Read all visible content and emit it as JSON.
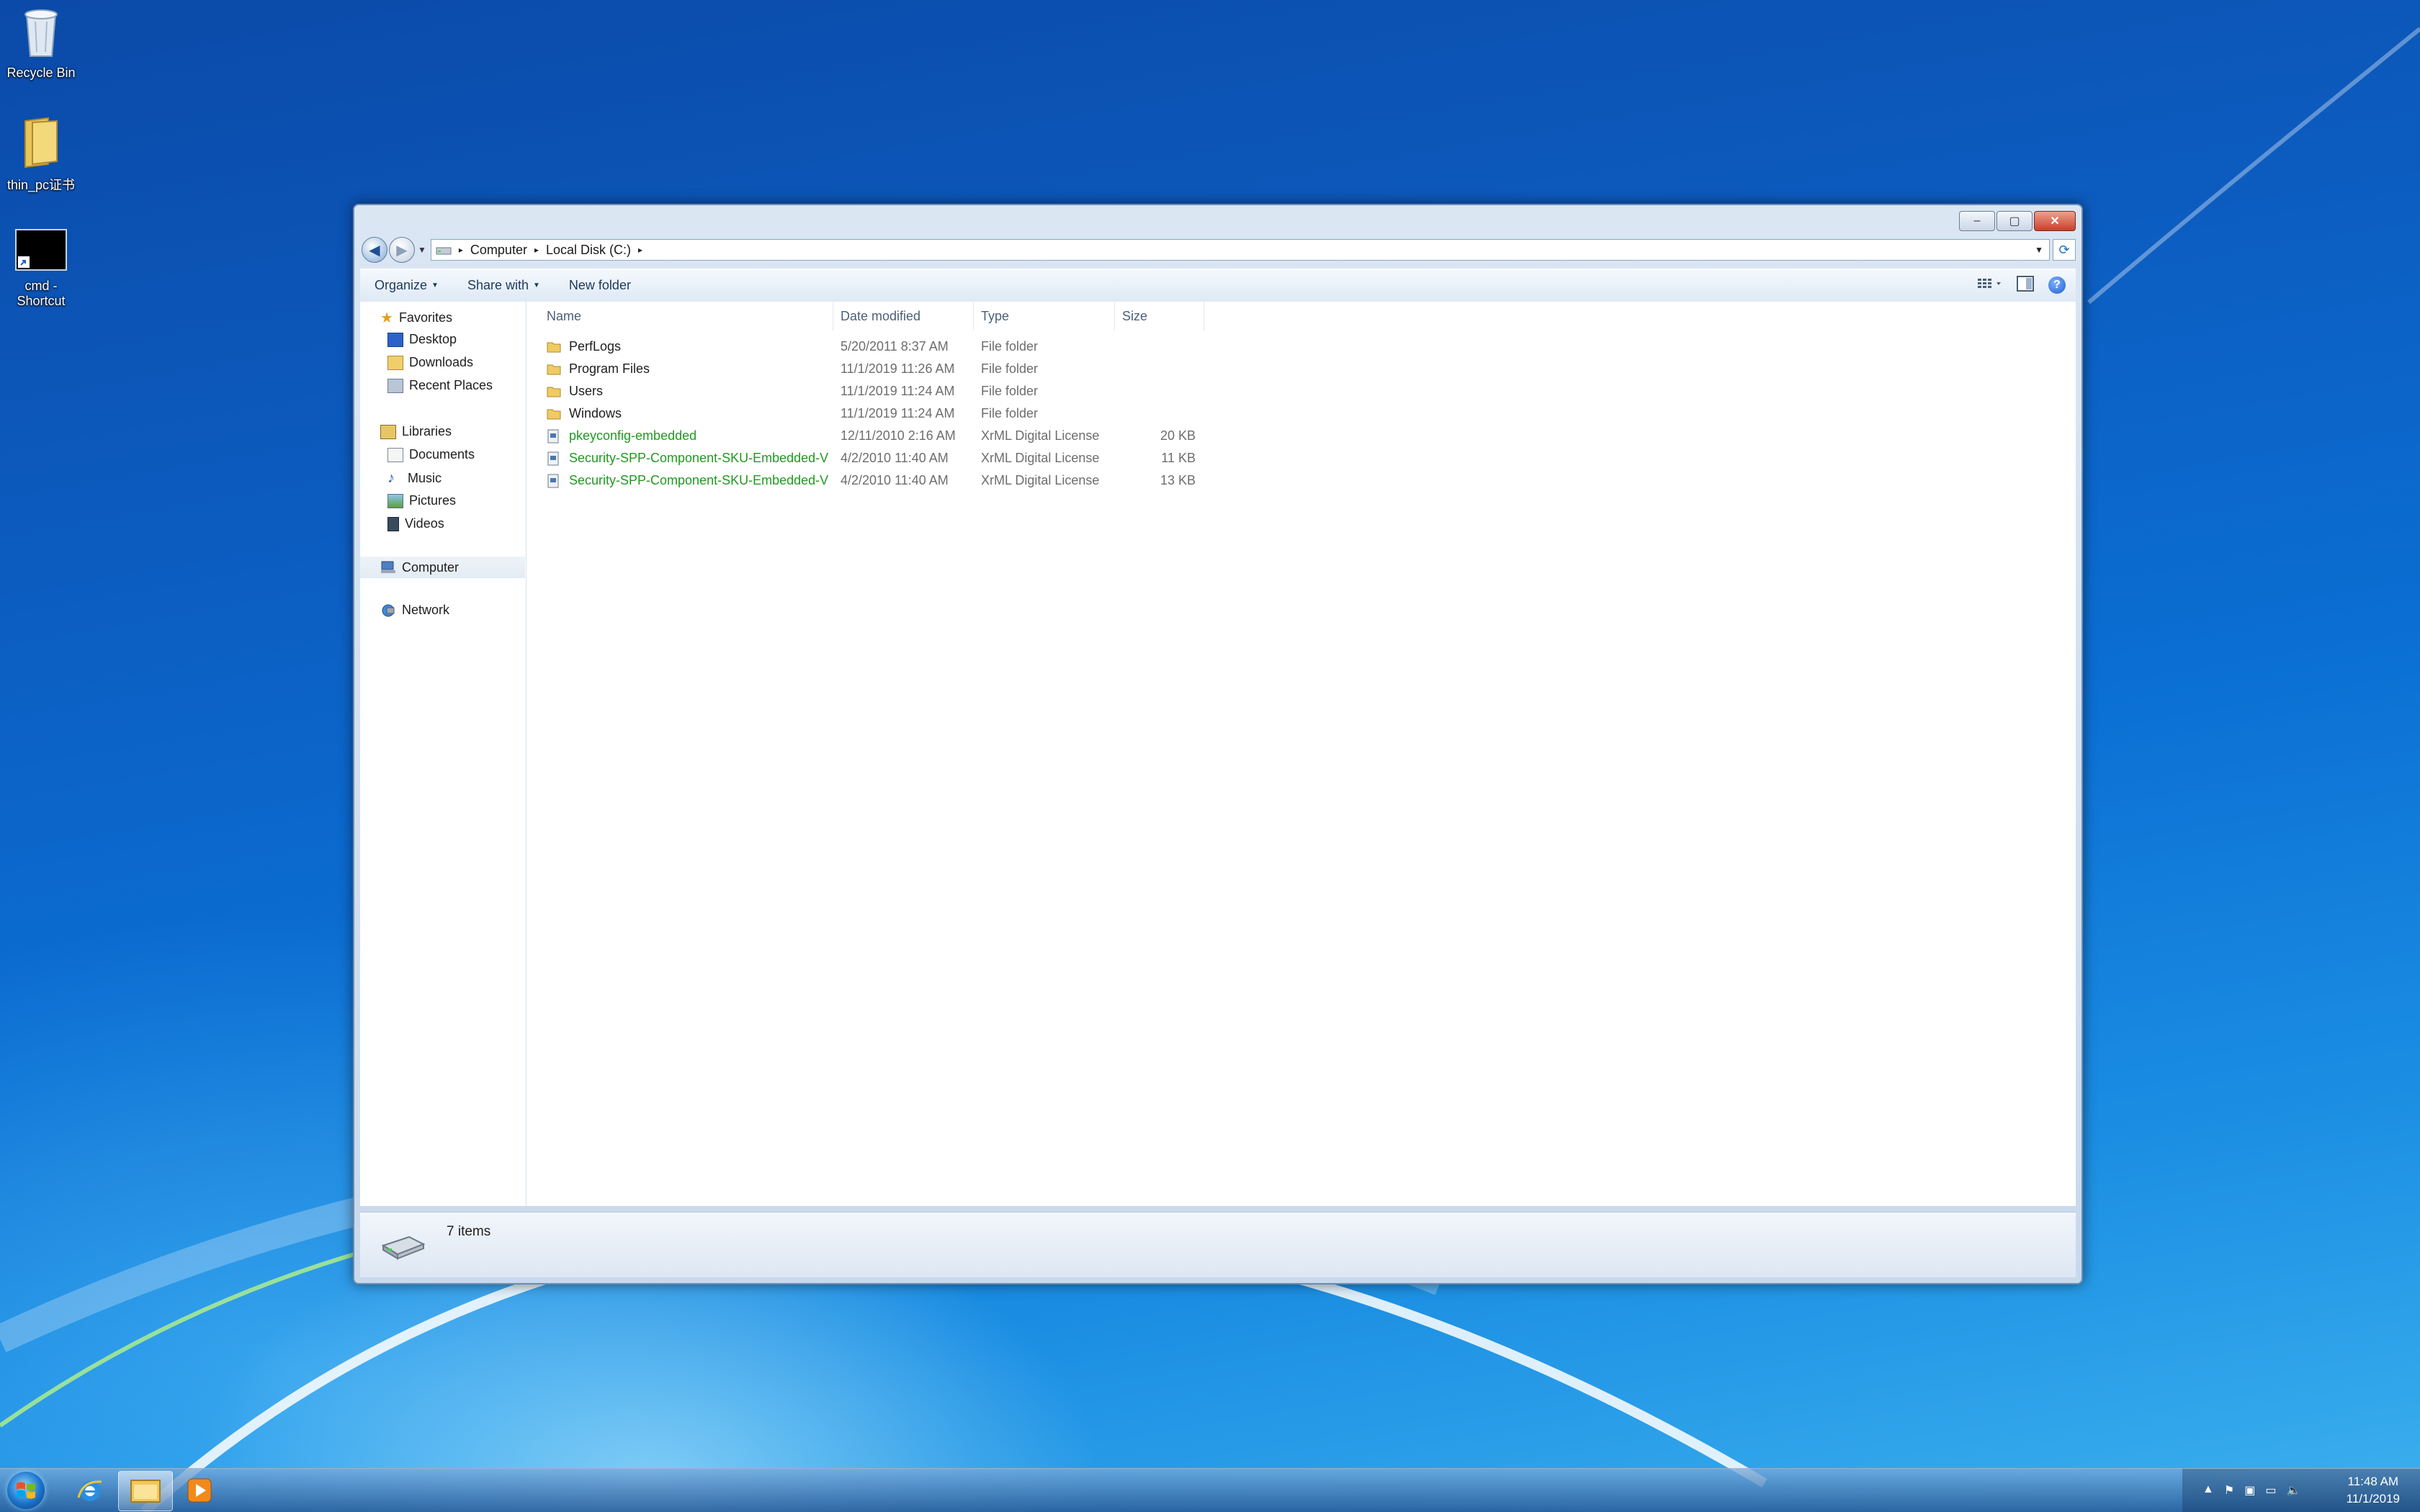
{
  "desktop": {
    "icons": [
      {
        "label": "Recycle Bin"
      },
      {
        "label": "thin_pc证书"
      },
      {
        "label": "cmd - Shortcut"
      }
    ]
  },
  "window": {
    "controls": {
      "minimize": "–",
      "maximize": "▢",
      "close": "✕"
    },
    "address": {
      "segments": [
        "Computer",
        "Local Disk (C:)"
      ],
      "separator": "▸"
    },
    "toolbar": {
      "organize": "Organize",
      "share_with": "Share with",
      "new_folder": "New folder"
    },
    "nav_pane": {
      "favorites": "Favorites",
      "desktop": "Desktop",
      "downloads": "Downloads",
      "recent_places": "Recent Places",
      "libraries": "Libraries",
      "documents": "Documents",
      "music": "Music",
      "pictures": "Pictures",
      "videos": "Videos",
      "computer": "Computer",
      "network": "Network"
    },
    "columns": {
      "name": "Name",
      "date": "Date modified",
      "type": "Type",
      "size": "Size"
    },
    "files": [
      {
        "name": "PerfLogs",
        "date": "5/20/2011 8:37 AM",
        "type": "File folder",
        "size": ""
      },
      {
        "name": "Program Files",
        "date": "11/1/2019 11:26 AM",
        "type": "File folder",
        "size": ""
      },
      {
        "name": "Users",
        "date": "11/1/2019 11:24 AM",
        "type": "File folder",
        "size": ""
      },
      {
        "name": "Windows",
        "date": "11/1/2019 11:24 AM",
        "type": "File folder",
        "size": ""
      },
      {
        "name": "pkeyconfig-embedded",
        "date": "12/11/2010 2:16 AM",
        "type": "XrML Digital License",
        "size": "20 KB"
      },
      {
        "name": "Security-SPP-Component-SKU-Embedded-VL...",
        "date": "4/2/2010 11:40 AM",
        "type": "XrML Digital License",
        "size": "11 KB"
      },
      {
        "name": "Security-SPP-Component-SKU-Embedded-VL...",
        "date": "4/2/2010 11:40 AM",
        "type": "XrML Digital License",
        "size": "13 KB"
      }
    ],
    "status": {
      "count": "7 items"
    }
  },
  "taskbar": {
    "clock": {
      "time": "11:48 AM",
      "date": "11/1/2019"
    }
  },
  "colors": {
    "license_name": "#1f9a1f",
    "accent": "#1e6fc0"
  }
}
